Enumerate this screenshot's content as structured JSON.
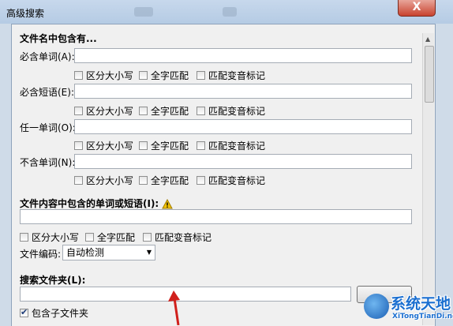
{
  "window": {
    "title": "高级搜索",
    "close_label": "X"
  },
  "filename_section": {
    "header": "文件名中包含有...",
    "rows": [
      {
        "label": "必含单词(A):",
        "value": ""
      },
      {
        "label": "必含短语(E):",
        "value": ""
      },
      {
        "label": "任一单词(O):",
        "value": ""
      },
      {
        "label": "不含单词(N):",
        "value": ""
      }
    ],
    "options": [
      "区分大小写",
      "全字匹配",
      "匹配变音标记"
    ]
  },
  "content_section": {
    "header": "文件内容中包含的单词或短语(I):",
    "value": "",
    "options": [
      "区分大小写",
      "全字匹配",
      "匹配变音标记"
    ],
    "encoding_label": "文件编码:",
    "encoding_value": "自动检测"
  },
  "folder_section": {
    "header": "搜索文件夹(L):",
    "value": "",
    "browse_label": "",
    "include_subfolders_label": "包含子文件夹",
    "include_subfolders_checked": true
  },
  "watermark": {
    "name": "系统天地",
    "url": "XiTongTianDi.net"
  },
  "colors": {
    "accent": "#1b6fd0",
    "arrow": "#d0201c",
    "warning": "#f2c200"
  }
}
